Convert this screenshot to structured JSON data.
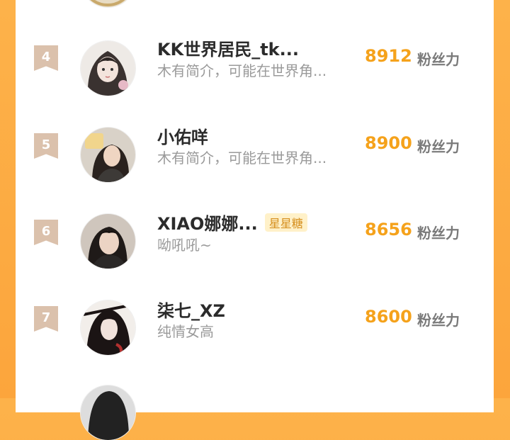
{
  "leaderboard": {
    "unit_label": "粉丝力",
    "rows": [
      {
        "rank": "4",
        "name": "KK世界居民_tk...",
        "desc": "木有简介，可能在世界角...",
        "badge": "",
        "score": "8912"
      },
      {
        "rank": "5",
        "name": "小佑咩",
        "desc": "木有简介，可能在世界角...",
        "badge": "",
        "score": "8900"
      },
      {
        "rank": "6",
        "name": "XIAO娜娜...",
        "desc": "呦吼吼~",
        "badge": "星星糖",
        "score": "8656"
      },
      {
        "rank": "7",
        "name": "柒七_XZ",
        "desc": "纯情女高",
        "badge": "",
        "score": "8600"
      }
    ]
  }
}
